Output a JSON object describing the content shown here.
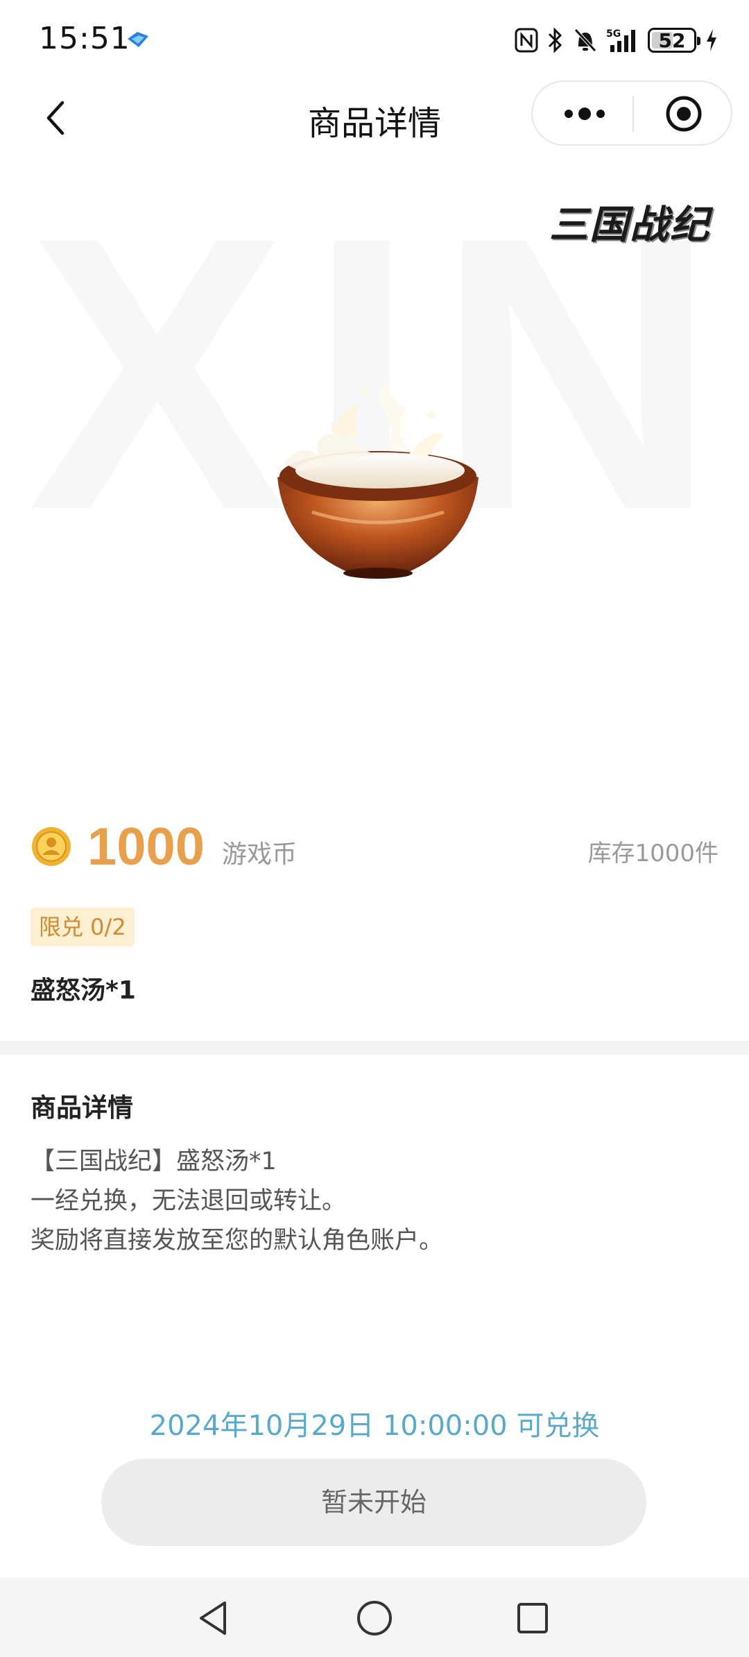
{
  "status_bar": {
    "time": "15:51",
    "network": "5G",
    "battery": "52",
    "battery_level": 0.52
  },
  "nav": {
    "title": "商品详情"
  },
  "hero": {
    "watermark": "XIN",
    "game_logo": "三国战纪"
  },
  "price": {
    "value": "1000",
    "unit": "游戏币",
    "stock": "库存1000件"
  },
  "limit_badge": "限兑 0/2",
  "product_name": "盛怒汤*1",
  "detail": {
    "title": "商品详情",
    "lines": [
      "【三国战纪】盛怒汤*1",
      "一经兑换，无法退回或转让。",
      "奖励将直接发放至您的默认角色账户。"
    ]
  },
  "redeem_time": "2024年10月29日 10:00:00 可兑换",
  "status_button": "暂未开始",
  "colors": {
    "price": "#e9a04d",
    "badge_bg": "#fdefd2",
    "badge_text": "#d08a30",
    "redeem_time": "#5ba9c9",
    "button_bg": "#ececec"
  }
}
